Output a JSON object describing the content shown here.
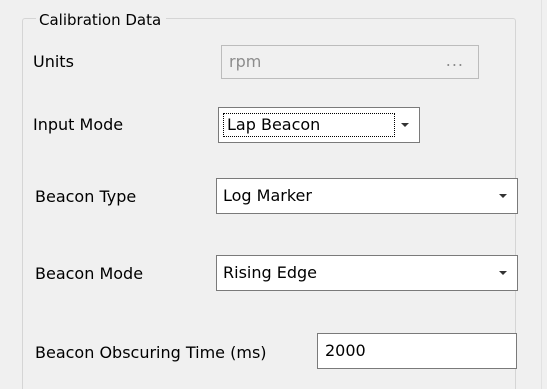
{
  "group": {
    "title": "Calibration Data"
  },
  "fields": {
    "units": {
      "label": "Units",
      "value": "rpm",
      "button_label": "...",
      "enabled": false
    },
    "input_mode": {
      "label": "Input Mode",
      "value": "Lap Beacon",
      "focused": true
    },
    "beacon_type": {
      "label": "Beacon Type",
      "value": "Log Marker"
    },
    "beacon_mode": {
      "label": "Beacon Mode",
      "value": "Rising Edge"
    },
    "beacon_obscuring_time": {
      "label": "Beacon Obscuring Time (ms)",
      "value": "2000"
    }
  },
  "icons": {
    "dropdown": "chevron-down-icon",
    "browse": "ellipsis-icon"
  }
}
